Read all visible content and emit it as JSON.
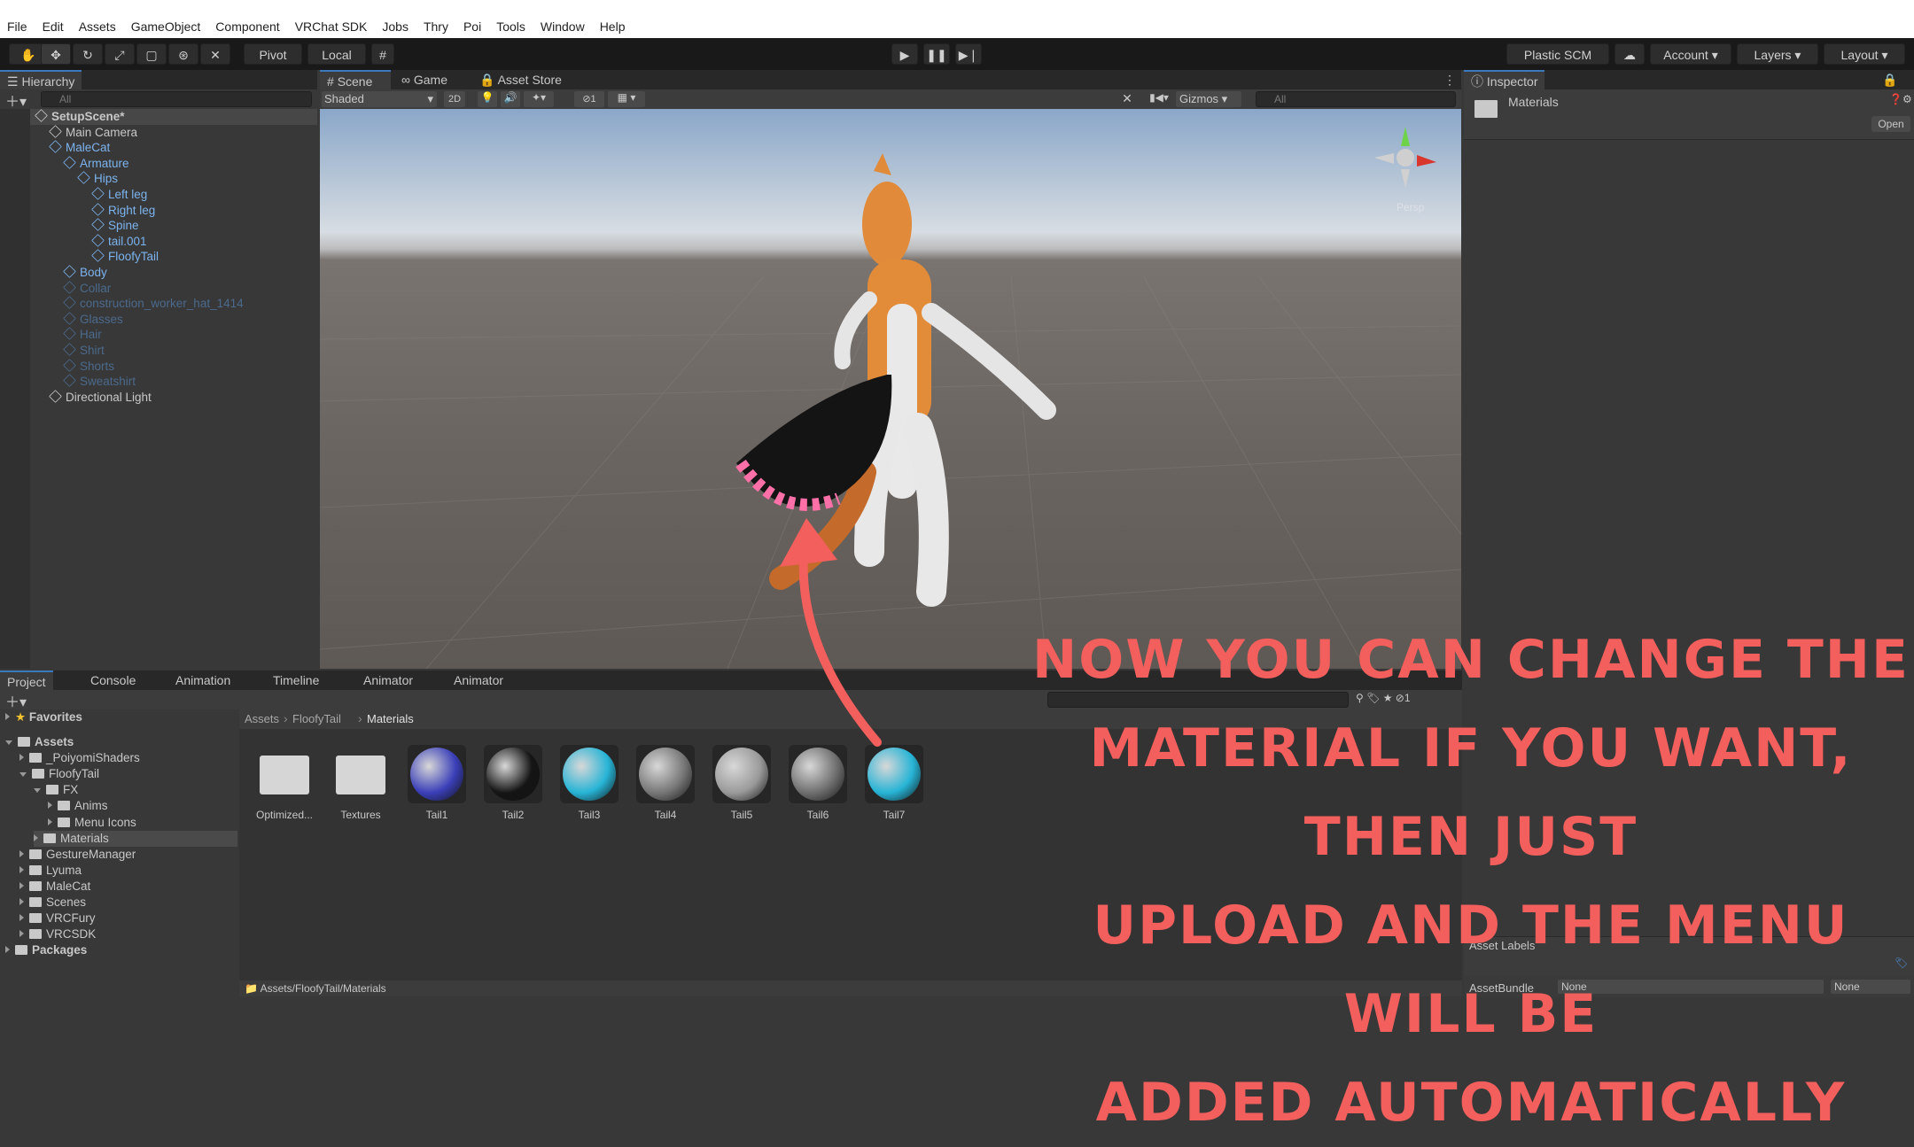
{
  "menubar": {
    "items": [
      "File",
      "Edit",
      "Assets",
      "GameObject",
      "Component",
      "VRChat SDK",
      "Jobs",
      "Thry",
      "Poi",
      "Tools",
      "Window",
      "Help"
    ]
  },
  "toolbar": {
    "pivot": "Pivot",
    "local": "Local",
    "plastic": "Plastic SCM",
    "account": "Account",
    "layers": "Layers",
    "layout": "Layout"
  },
  "hierarchy": {
    "tab": "Hierarchy",
    "search_placeholder": "All",
    "rows": [
      {
        "label": "SetupScene*",
        "indent": 0,
        "kind": "scene"
      },
      {
        "label": "Main Camera",
        "indent": 1,
        "kind": "object"
      },
      {
        "label": "MaleCat",
        "indent": 1,
        "kind": "prefab"
      },
      {
        "label": "Armature",
        "indent": 2,
        "kind": "prefab"
      },
      {
        "label": "Hips",
        "indent": 3,
        "kind": "prefab"
      },
      {
        "label": "Left leg",
        "indent": 4,
        "kind": "prefab"
      },
      {
        "label": "Right leg",
        "indent": 4,
        "kind": "prefab"
      },
      {
        "label": "Spine",
        "indent": 4,
        "kind": "prefab"
      },
      {
        "label": "tail.001",
        "indent": 4,
        "kind": "prefab"
      },
      {
        "label": "FloofyTail",
        "indent": 4,
        "kind": "prefab"
      },
      {
        "label": "Body",
        "indent": 2,
        "kind": "prefab"
      },
      {
        "label": "Collar",
        "indent": 2,
        "kind": "disabled"
      },
      {
        "label": "construction_worker_hat_1414",
        "indent": 2,
        "kind": "disabled"
      },
      {
        "label": "Glasses",
        "indent": 2,
        "kind": "disabled"
      },
      {
        "label": "Hair",
        "indent": 2,
        "kind": "disabled"
      },
      {
        "label": "Shirt",
        "indent": 2,
        "kind": "disabled"
      },
      {
        "label": "Shorts",
        "indent": 2,
        "kind": "disabled"
      },
      {
        "label": "Sweatshirt",
        "indent": 2,
        "kind": "disabled"
      },
      {
        "label": "Directional Light",
        "indent": 1,
        "kind": "object"
      }
    ]
  },
  "scene_tabs": {
    "scene": "Scene",
    "game": "Game",
    "asset_store": "Asset Store"
  },
  "scene_toolbar": {
    "shading": "Shaded",
    "mode_2d": "2D",
    "gizmos": "Gizmos",
    "search_placeholder": "All",
    "hidden_count": "1"
  },
  "scene_view": {
    "persp_label": "Persp"
  },
  "inspector": {
    "tab": "Inspector",
    "title": "Materials",
    "open_button": "Open",
    "asset_labels": "Asset Labels",
    "asset_bundle": "AssetBundle",
    "bundle_value": "None",
    "bundle_variant": "None"
  },
  "bottom_tabs": [
    "Project",
    "Console",
    "Animation",
    "Timeline",
    "Animator",
    "Animator"
  ],
  "project": {
    "favorites": "Favorites",
    "tree": [
      {
        "label": "Assets",
        "indent": 0
      },
      {
        "label": "_PoiyomiShaders",
        "indent": 1
      },
      {
        "label": "FloofyTail",
        "indent": 1
      },
      {
        "label": "FX",
        "indent": 2
      },
      {
        "label": "Anims",
        "indent": 3
      },
      {
        "label": "Menu Icons",
        "indent": 3
      },
      {
        "label": "Materials",
        "indent": 2
      },
      {
        "label": "GestureManager",
        "indent": 1
      },
      {
        "label": "Lyuma",
        "indent": 1
      },
      {
        "label": "MaleCat",
        "indent": 1
      },
      {
        "label": "Scenes",
        "indent": 1
      },
      {
        "label": "VRCFury",
        "indent": 1
      },
      {
        "label": "VRCSDK",
        "indent": 1
      },
      {
        "label": "Packages",
        "indent": 0
      }
    ],
    "breadcrumb": [
      "Assets",
      "FloofyTail",
      "Materials"
    ],
    "hidden_count": "1",
    "assets": [
      {
        "label": "Optimized...",
        "kind": "folder"
      },
      {
        "label": "Textures",
        "kind": "folder"
      },
      {
        "label": "Tail1",
        "kind": "material",
        "color": "#3a3fb8"
      },
      {
        "label": "Tail2",
        "kind": "material",
        "color": "#151515"
      },
      {
        "label": "Tail3",
        "kind": "material",
        "color": "#27b4d6"
      },
      {
        "label": "Tail4",
        "kind": "material",
        "color": "#777777"
      },
      {
        "label": "Tail5",
        "kind": "material",
        "color": "#9a9a9a"
      },
      {
        "label": "Tail6",
        "kind": "material",
        "color": "#6f6f6f"
      },
      {
        "label": "Tail7",
        "kind": "material",
        "color": "#27b4d6"
      }
    ],
    "status_path": "Assets/FloofyTail/Materials"
  },
  "annotation": {
    "lines": [
      "Now you can change the",
      "material if you want, then just",
      "upload and the menu will be",
      "added automatically"
    ],
    "color": "#f25f5c"
  }
}
